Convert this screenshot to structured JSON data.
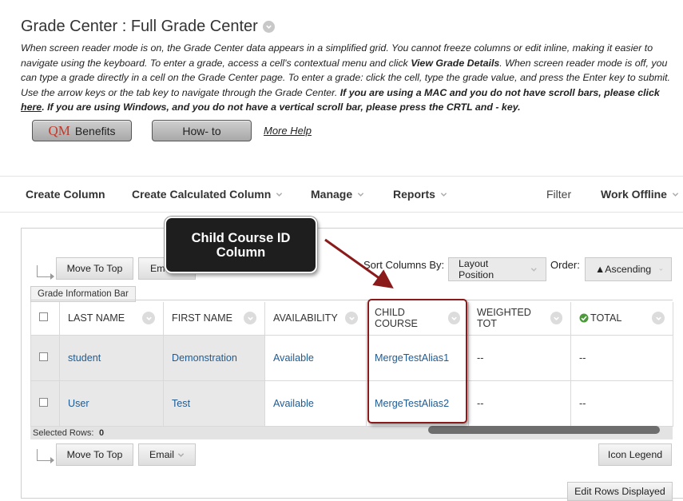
{
  "page": {
    "title": "Grade Center : Full Grade Center",
    "desc_p1": "When screen reader mode is on, the Grade Center data appears in a simplified grid. You cannot freeze columns or edit inline, making it easier to navigate using the keyboard. To enter a grade, access a cell's contextual menu and click ",
    "desc_b1": "View Grade Details",
    "desc_p2": ". When screen reader mode is off, you can type a grade directly in a cell on the Grade Center page. To enter a grade: click the cell, type the grade value, and press the Enter key to submit. Use the arrow keys or the tab key to navigate through the Grade Center. ",
    "desc_b2": "If you are using a MAC and you do not have scroll bars, please click ",
    "desc_link": "here",
    "desc_b3": ". If you are using Windows, and you do not have a vertical scroll bar, please press the CRTL and - key."
  },
  "buttons": {
    "qm_logo": "QM",
    "benefits": "Benefits",
    "howto": "How- to",
    "more_help": "More Help"
  },
  "actionbar": {
    "create_column": "Create Column",
    "create_calc": "Create Calculated Column",
    "manage": "Manage",
    "reports": "Reports",
    "filter": "Filter",
    "work_offline": "Work Offline"
  },
  "grid": {
    "move_to_top": "Move To Top",
    "email_partial": "Em",
    "email": "Email",
    "sort_by_label": "Sort Columns By:",
    "sort_by_value": "Layout Position",
    "order_label": "Order:",
    "order_value": "▲Ascending",
    "info_bar": "Grade Information Bar",
    "columns": [
      "LAST NAME",
      "FIRST NAME",
      "AVAILABILITY",
      "CHILD COURSE",
      "WEIGHTED TOT",
      "TOTAL"
    ],
    "rows": [
      {
        "last": "student",
        "first": "Demonstration",
        "avail": "Available",
        "child": "MergeTestAlias1",
        "weighted": "--",
        "total": "--"
      },
      {
        "last": "User",
        "first": "Test",
        "avail": "Available",
        "child": "MergeTestAlias2",
        "weighted": "--",
        "total": "--"
      }
    ],
    "selected_rows_label": "Selected Rows:",
    "selected_rows_count": "0",
    "icon_legend": "Icon Legend",
    "edit_rows": "Edit Rows Displayed"
  },
  "callout": {
    "text": "Child Course ID Column"
  },
  "colors": {
    "link": "#1f5b93",
    "highlight": "#8b1a1a",
    "callout_bg": "#1e1e1e",
    "qm_red": "#c0392b"
  }
}
